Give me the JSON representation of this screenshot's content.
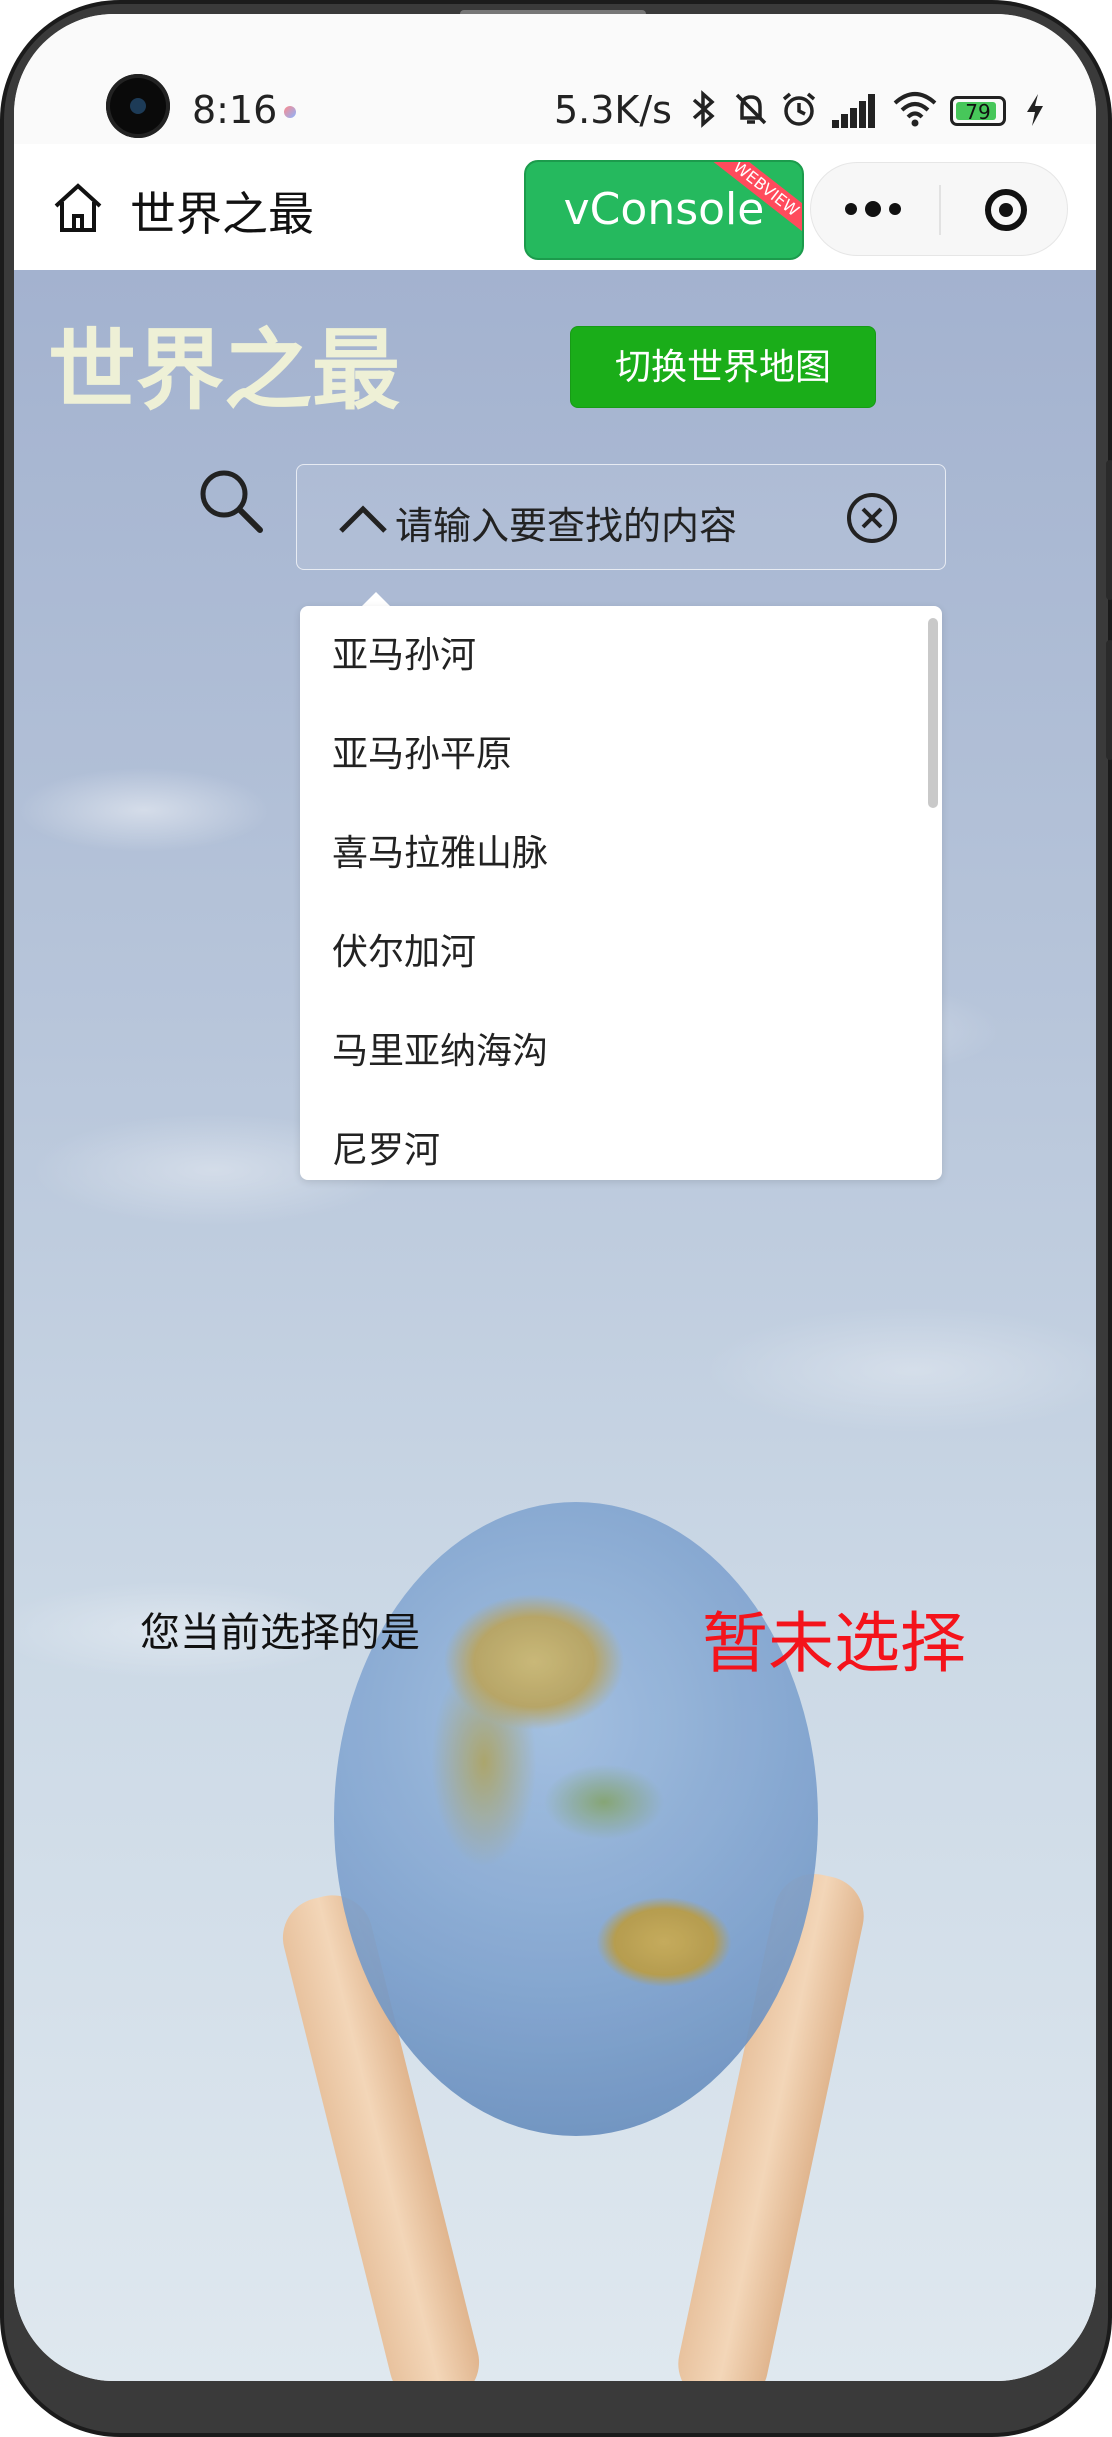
{
  "status_bar": {
    "time": "8:16",
    "net_speed": "5.3K/s",
    "battery_level": "79",
    "icons": [
      "camera-icon",
      "bluetooth-icon",
      "mute-bell-icon",
      "alarm-icon",
      "signal-icon",
      "wifi-icon",
      "battery-icon",
      "charging-icon"
    ]
  },
  "nav_bar": {
    "title": "世界之最",
    "vconsole_label": "vConsole",
    "webview_tag": "WEBVIEW"
  },
  "header": {
    "title": "世界之最",
    "switch_map_label": "切换世界地图"
  },
  "search": {
    "placeholder": "请输入要查找的内容"
  },
  "dropdown": {
    "items": [
      "亚马孙河",
      "亚马孙平原",
      "喜马拉雅山脉",
      "伏尔加河",
      "马里亚纳海沟",
      "尼罗河"
    ]
  },
  "selection": {
    "label": "您当前选择的是",
    "value": "暂未选择",
    "value_color": "#f4131b"
  },
  "colors": {
    "accent_green": "#1aad19",
    "vconsole_green": "#25b95e",
    "title_color": "#eef0d6"
  }
}
